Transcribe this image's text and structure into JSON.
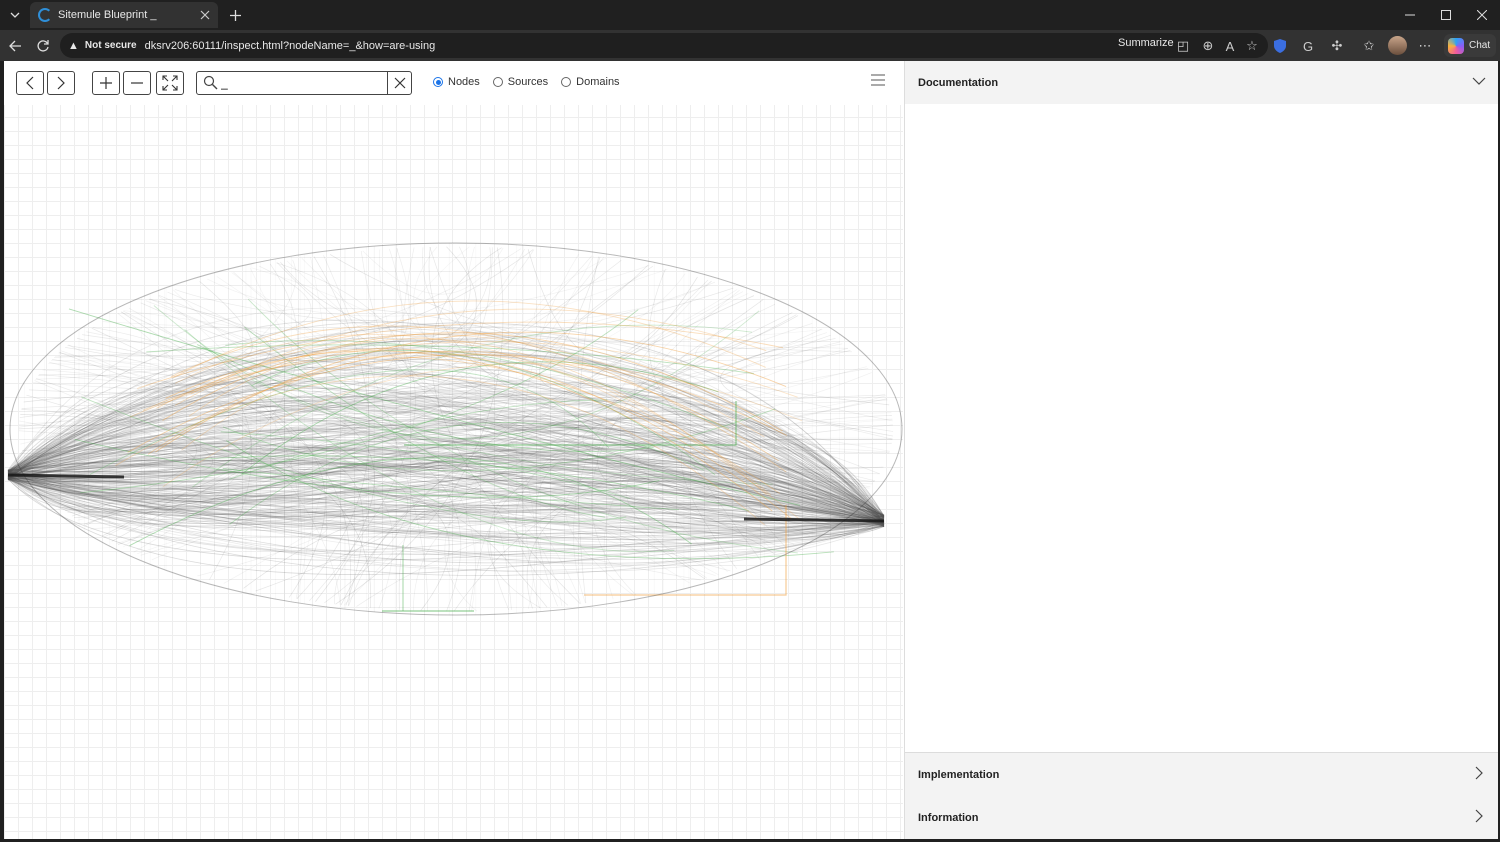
{
  "browser": {
    "tab_title": "Sitemule Blueprint _",
    "security_label": "Not secure",
    "url": "dksrv206:60111/inspect.html?nodeName=_&how=are-using",
    "summarize_label": "Summarize",
    "chat_label": "Chat"
  },
  "toolbar": {
    "search_value": "_",
    "radios": [
      {
        "label": "Nodes",
        "checked": true
      },
      {
        "label": "Sources",
        "checked": false
      },
      {
        "label": "Domains",
        "checked": false
      }
    ]
  },
  "panels": {
    "documentation": "Documentation",
    "implementation": "Implementation",
    "information": "Information"
  },
  "colors": {
    "accent": "#1a73e8",
    "edge_gray": "#555555",
    "edge_green": "#4caf50",
    "edge_orange": "#f0a040"
  }
}
